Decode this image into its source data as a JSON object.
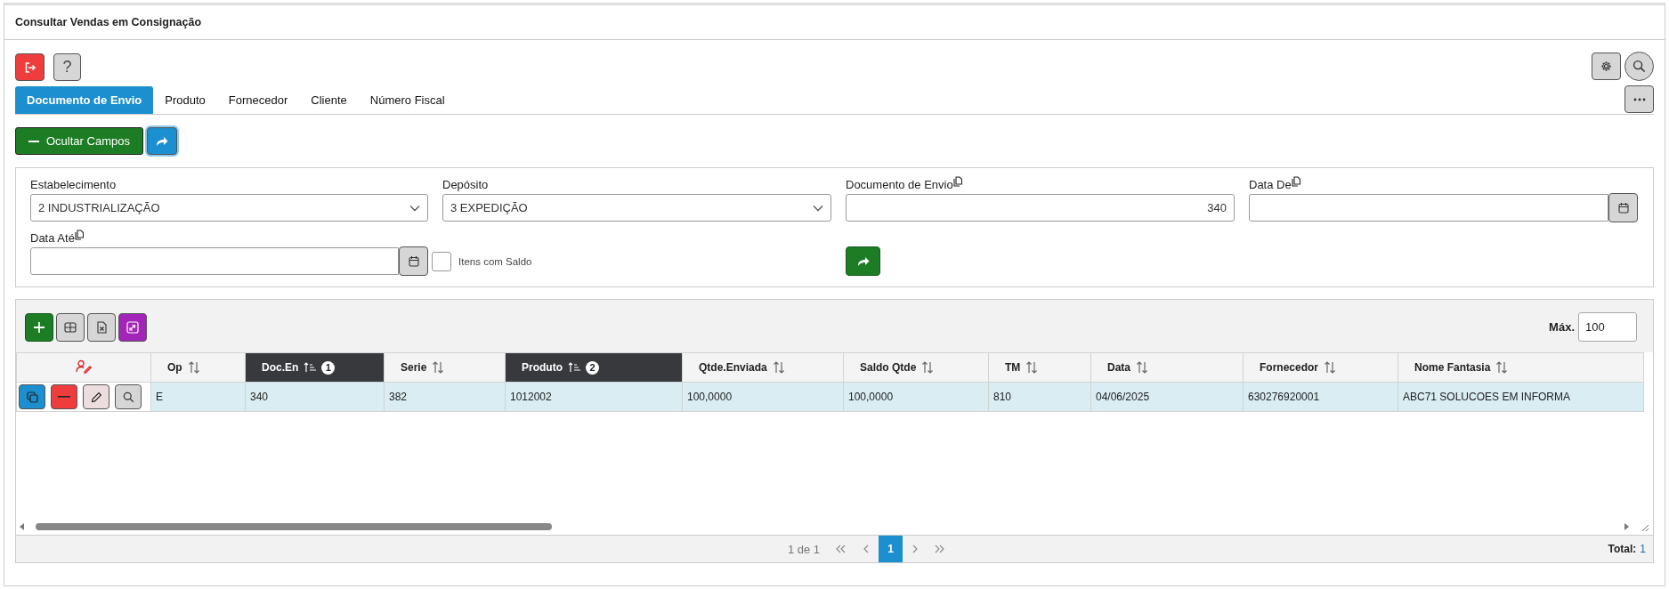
{
  "title": "Consultar Vendas em Consignação",
  "help_button": "?",
  "tabs": [
    {
      "label": "Documento de Envio",
      "selected": true
    },
    {
      "label": "Produto",
      "selected": false
    },
    {
      "label": "Fornecedor",
      "selected": false
    },
    {
      "label": "Cliente",
      "selected": false
    },
    {
      "label": "Número Fiscal",
      "selected": false
    }
  ],
  "hide_fields_button": "Ocultar Campos",
  "filters": [
    {
      "kind": "select",
      "label": "Estabelecimento",
      "value": "2 INDUSTRIALIZAÇÃO"
    },
    {
      "kind": "select",
      "label": "Depósito",
      "value": "3 EXPEDIÇÃO"
    },
    {
      "kind": "number",
      "label": "Documento de Envio",
      "copy_icon": true,
      "value": "340"
    },
    {
      "kind": "date",
      "label": "Data De",
      "copy_icon": true
    },
    {
      "kind": "date",
      "label": "Data Até",
      "copy_icon": true
    },
    {
      "kind": "checkbox",
      "label": "Itens com Saldo",
      "checked": false
    }
  ],
  "grid": {
    "max_label": "Máx.",
    "max_value": "100",
    "columns": [
      {
        "label": "Op",
        "sorted": false
      },
      {
        "label": "Doc.En",
        "sorted": true,
        "sort_order": "1"
      },
      {
        "label": "Serie",
        "sorted": false
      },
      {
        "label": "Produto",
        "sorted": true,
        "sort_order": "2"
      },
      {
        "label": "Qtde.Enviada",
        "sorted": false
      },
      {
        "label": "Saldo Qtde",
        "sorted": false
      },
      {
        "label": "TM",
        "sorted": false
      },
      {
        "label": "Data",
        "sorted": false
      },
      {
        "label": "Fornecedor",
        "sorted": false
      },
      {
        "label": "Nome Fantasia",
        "sorted": false
      }
    ],
    "rows": [
      {
        "selected": true,
        "cells": [
          "E",
          "340",
          "382",
          "1012002",
          "100,0000",
          "100,0000",
          "810",
          "04/06/2025",
          "630276920001",
          "ABC71 SOLUCOES EM INFORMA"
        ]
      }
    ]
  },
  "pagination": {
    "summary": "1 de 1",
    "pages": [
      {
        "label": "1",
        "selected": true
      }
    ],
    "total_label": "Total:",
    "total": "1"
  }
}
